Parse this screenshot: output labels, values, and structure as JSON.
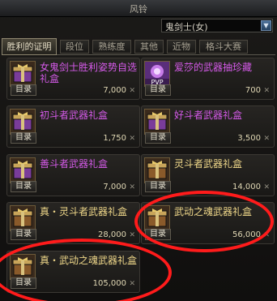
{
  "window": {
    "title": "风铃"
  },
  "character_select": {
    "value": "鬼剑士(女)"
  },
  "tabs": [
    {
      "label": "胜利的证明",
      "active": true
    },
    {
      "label": "段位",
      "active": false
    },
    {
      "label": "熟练度",
      "active": false
    },
    {
      "label": "其他",
      "active": false
    },
    {
      "label": "近物",
      "active": false
    },
    {
      "label": "格斗大赛",
      "active": false
    }
  ],
  "items": [
    {
      "name": "女鬼剑士胜利姿势自选礼盒",
      "price": "7,000",
      "category": "目录",
      "name_color": "#d55ae9",
      "icon": "gift-box-icon"
    },
    {
      "name": "爱莎的武器抽珍藏",
      "price": "700",
      "category": "目录",
      "name_color": "#d55ae9",
      "icon": "pvp-card-icon",
      "icon_text": "PVP"
    },
    {
      "name": "初斗者武器礼盒",
      "price": "1,750",
      "category": "目录",
      "name_color": "#d55ae9",
      "icon": "chest-icon"
    },
    {
      "name": "好斗者武器礼盒",
      "price": "3,500",
      "category": "目录",
      "name_color": "#d55ae9",
      "icon": "chest-icon"
    },
    {
      "name": "善斗者武器礼盒",
      "price": "7,000",
      "category": "目录",
      "name_color": "#d55ae9",
      "icon": "chest-icon"
    },
    {
      "name": "灵斗者武器礼盒",
      "price": "14,000",
      "category": "目录",
      "name_color": "#f0d88a",
      "icon": "chest-icon"
    },
    {
      "name": "真・灵斗者武器礼盒",
      "price": "28,000",
      "category": "目录",
      "name_color": "#f0d88a",
      "icon": "chest-icon"
    },
    {
      "name": "武动之魂武器礼盒",
      "price": "56,000",
      "category": "目录",
      "name_color": "#f0d88a",
      "icon": "chest-icon"
    },
    {
      "name": "真・武动之魂武器礼盒",
      "price": "105,000",
      "category": "目录",
      "name_color": "#f0d88a",
      "icon": "chest-icon"
    }
  ],
  "currency_mark": "✕",
  "colors": {
    "highlight": "#ff1b1b",
    "epic": "#d55ae9",
    "legendary": "#f0d88a"
  }
}
